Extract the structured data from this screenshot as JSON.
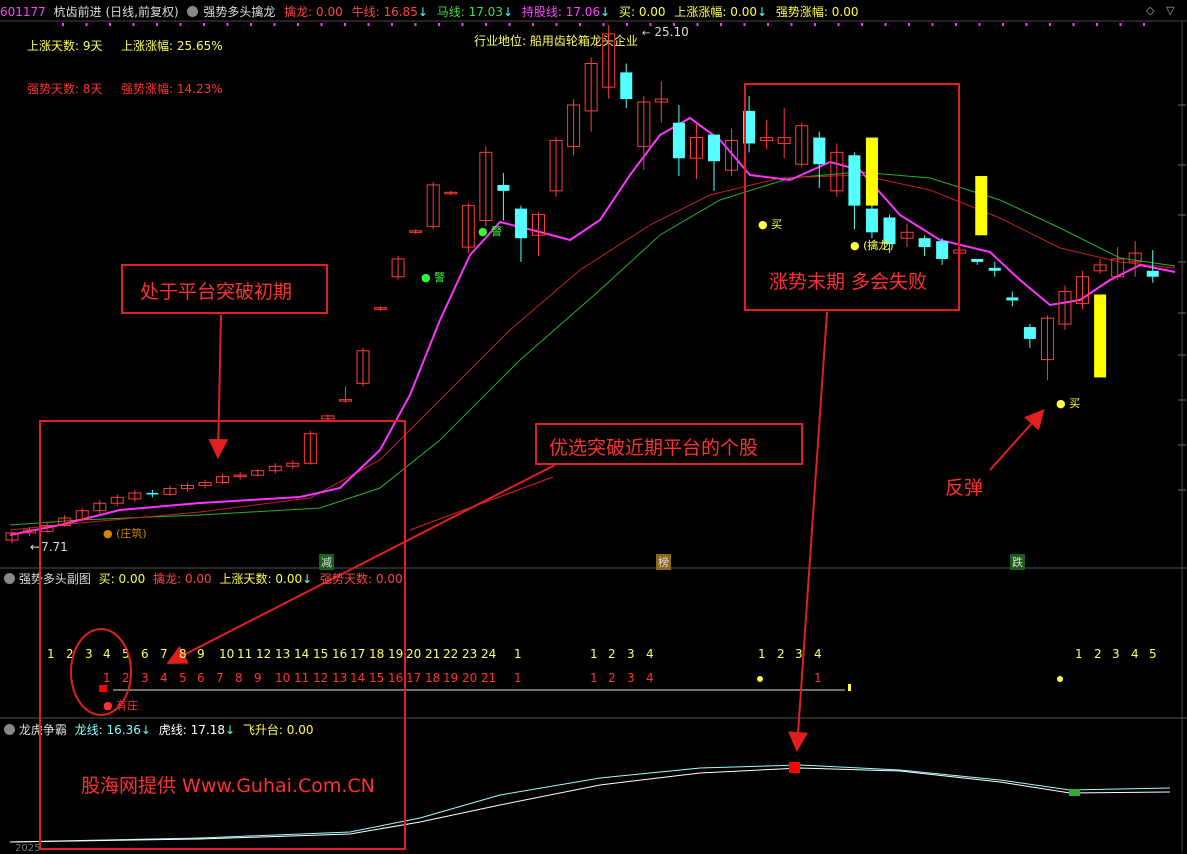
{
  "header": {
    "code": "601177",
    "name": "杭齿前进",
    "period": "(日线,前复权)",
    "indicator": "强势多头擒龙",
    "qinlong_label": "擒龙:",
    "qinlong_value": "0.00",
    "niuxian_label": "牛线:",
    "niuxian_value": "16.85",
    "maxian_label": "马线:",
    "maxian_value": "17.03",
    "chigu_label": "持股线:",
    "chigu_value": "17.06",
    "mai_label": "买:",
    "mai_value": "0.00",
    "zhangfu_label": "上涨涨幅:",
    "zhangfu_value": "0.00",
    "qiangshi_label": "强势涨幅:",
    "qiangshi_value": "0.00",
    "arrow_down": "↓"
  },
  "window_buttons": {
    "diamond": "◇",
    "chevron": "▽"
  },
  "stats": {
    "up_days": "上涨天数: 9天",
    "up_gain": "上涨涨幅: 25.65%",
    "strong_days": "强势天数: 8天",
    "strong_gain": "强势涨幅: 14.23%"
  },
  "industry": "行业地位: 船用齿轮箱龙头企业",
  "price_marks": {
    "high": "25.10",
    "low": "7.71",
    "high_arrow": "←",
    "low_arrow": "←"
  },
  "signals": {
    "jing1": "警",
    "jing2": "警",
    "mai1": "买",
    "mai2": "买",
    "qinlong": "(擒龙)",
    "zhuangshi": "(庄筑)"
  },
  "event_tags": {
    "jian": "减",
    "bang": "榜",
    "die": "跌"
  },
  "sub1": {
    "title": "强势多头副图",
    "mai_label": "买:",
    "mai_value": "0.00",
    "qinlong_label": "擒龙:",
    "qinlong_value": "0.00",
    "updays_label": "上涨天数:",
    "updays_value": "0.00",
    "strongdays_label": "强势天数:",
    "strongdays_value": "0.00",
    "youzhuang": "有庄",
    "top_counts": [
      "1",
      "2",
      "3",
      "4",
      "5",
      "6",
      "7",
      "8",
      "9",
      "10",
      "11",
      "12",
      "13",
      "14",
      "15",
      "16",
      "17",
      "18",
      "19",
      "20",
      "21",
      "22",
      "23",
      "24",
      "1",
      "1",
      "2",
      "3",
      "4",
      "1",
      "2",
      "3",
      "4",
      "1",
      "2",
      "3",
      "4",
      "5"
    ],
    "bottom_counts": [
      "1",
      "2",
      "3",
      "4",
      "5",
      "6",
      "7",
      "8",
      "9",
      "10",
      "11",
      "12",
      "13",
      "14",
      "15",
      "16",
      "17",
      "18",
      "19",
      "20",
      "21",
      "1",
      "1",
      "2",
      "3",
      "4",
      "1"
    ]
  },
  "sub2": {
    "title": "龙虎争霸",
    "long_label": "龙线:",
    "long_value": "16.36",
    "hu_label": "虎线:",
    "hu_value": "17.18",
    "fei_label": "飞升台:",
    "fei_value": "0.00",
    "year_label": "2025"
  },
  "annotations": {
    "platform_early": "处于平台突破初期",
    "prefer_recent": "优选突破近期平台的个股",
    "late_trend": "涨势末期 多会失败",
    "rebound": "反弹",
    "source": "股海网提供 Www.Guhai.Com.CN"
  },
  "colors": {
    "bg": "#000000",
    "up": "#ff3a3a",
    "down": "#54ffff",
    "magenta": "#ff33ff",
    "red_ma": "#c02020",
    "green_ma": "#28b028",
    "yellow": "#ffff00",
    "annot": "#e02020"
  },
  "candles": [
    [
      7.71,
      7.95,
      7.6,
      8.0
    ],
    [
      7.95,
      8.05,
      7.85,
      8.15
    ],
    [
      8.0,
      8.2,
      7.95,
      8.3
    ],
    [
      8.2,
      8.45,
      8.15,
      8.55
    ],
    [
      8.4,
      8.7,
      8.35,
      8.8
    ],
    [
      8.7,
      8.95,
      8.6,
      9.05
    ],
    [
      8.95,
      9.15,
      8.85,
      9.25
    ],
    [
      9.1,
      9.3,
      9.0,
      9.4
    ],
    [
      9.3,
      9.25,
      9.15,
      9.4
    ],
    [
      9.25,
      9.45,
      9.2,
      9.55
    ],
    [
      9.45,
      9.55,
      9.35,
      9.65
    ],
    [
      9.55,
      9.65,
      9.45,
      9.75
    ],
    [
      9.65,
      9.85,
      9.6,
      9.95
    ],
    [
      9.85,
      9.9,
      9.75,
      10.0
    ],
    [
      9.9,
      10.05,
      9.85,
      10.1
    ],
    [
      10.05,
      10.2,
      9.95,
      10.3
    ],
    [
      10.2,
      10.3,
      10.1,
      10.4
    ],
    [
      10.3,
      11.3,
      10.25,
      11.4
    ],
    [
      11.8,
      11.9,
      11.75,
      11.95
    ],
    [
      12.4,
      12.45,
      12.35,
      12.9
    ],
    [
      13.0,
      14.1,
      12.9,
      14.2
    ],
    [
      15.5,
      15.55,
      15.45,
      15.6
    ],
    [
      16.6,
      17.2,
      16.5,
      17.3
    ],
    [
      18.1,
      18.15,
      18.05,
      18.2
    ],
    [
      18.3,
      19.7,
      18.2,
      19.8
    ],
    [
      19.4,
      19.45,
      19.35,
      19.5
    ],
    [
      17.6,
      19.0,
      17.4,
      19.1
    ],
    [
      18.5,
      20.8,
      18.3,
      21.0
    ],
    [
      19.7,
      19.5,
      18.5,
      20.1
    ],
    [
      18.9,
      17.9,
      17.1,
      19.0
    ],
    [
      18.0,
      18.7,
      17.3,
      18.8
    ],
    [
      19.5,
      21.2,
      19.3,
      21.3
    ],
    [
      21.0,
      22.4,
      20.7,
      22.6
    ],
    [
      22.2,
      23.8,
      21.5,
      24.0
    ],
    [
      23.0,
      24.8,
      22.6,
      25.1
    ],
    [
      23.5,
      22.6,
      22.3,
      23.8
    ],
    [
      21.0,
      22.5,
      20.2,
      22.7
    ],
    [
      22.5,
      22.6,
      21.8,
      23.2
    ],
    [
      21.8,
      20.6,
      20.0,
      22.4
    ],
    [
      20.6,
      21.3,
      19.9,
      21.8
    ],
    [
      21.4,
      20.5,
      19.5,
      21.4
    ],
    [
      20.2,
      21.2,
      20.0,
      21.6
    ],
    [
      22.2,
      21.1,
      20.8,
      22.7
    ],
    [
      21.2,
      21.3,
      20.9,
      21.9
    ],
    [
      21.1,
      21.3,
      20.6,
      22.3
    ],
    [
      20.4,
      21.7,
      20.3,
      21.8
    ],
    [
      21.3,
      20.4,
      19.6,
      21.5
    ],
    [
      19.5,
      20.8,
      19.3,
      21.1
    ],
    [
      20.7,
      19.0,
      18.2,
      20.8
    ],
    [
      18.9,
      18.1,
      17.9,
      19.2
    ],
    [
      18.6,
      17.7,
      17.4,
      18.7
    ],
    [
      17.9,
      18.1,
      17.6,
      18.4
    ],
    [
      17.9,
      17.6,
      17.3,
      18.0
    ],
    [
      17.8,
      17.2,
      17.0,
      17.9
    ],
    [
      17.4,
      17.5,
      17.2,
      17.6
    ],
    [
      17.2,
      17.1,
      17.0,
      17.2
    ],
    [
      16.9,
      16.8,
      16.6,
      17.1
    ],
    [
      15.9,
      15.8,
      15.6,
      16.1
    ],
    [
      14.9,
      14.5,
      14.2,
      15.0
    ],
    [
      13.8,
      15.2,
      13.1,
      15.3
    ],
    [
      15.0,
      16.1,
      14.8,
      16.3
    ],
    [
      15.7,
      16.6,
      15.5,
      16.8
    ],
    [
      16.8,
      17.0,
      16.7,
      17.2
    ],
    [
      16.6,
      17.2,
      16.5,
      17.6
    ],
    [
      17.1,
      17.4,
      16.6,
      17.8
    ],
    [
      16.8,
      16.6,
      16.4,
      17.5
    ]
  ]
}
